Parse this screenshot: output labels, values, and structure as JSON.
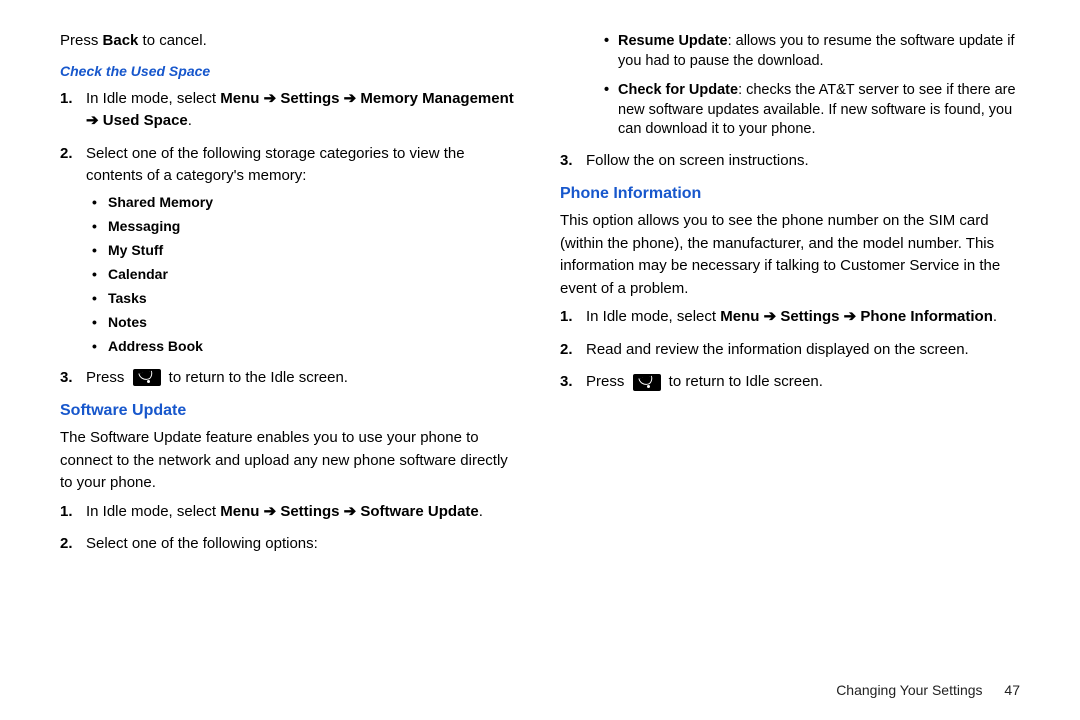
{
  "left": {
    "intro_press": "Press ",
    "intro_back": "Back",
    "intro_cancel": " to cancel.",
    "check_heading": "Check the Used Space",
    "step1_a": "In Idle mode, select ",
    "step1_b": "Menu ➔ Settings ➔ Memory Management ➔ Used Space",
    "step1_c": ".",
    "step2": "Select one of the following storage categories to view the contents of a category's memory:",
    "bullets": {
      "b1": "Shared Memory",
      "b2": "Messaging",
      "b3": "My Stuff",
      "b4": "Calendar",
      "b5": "Tasks",
      "b6": "Notes",
      "b7": "Address Book"
    },
    "step3_a": "Press ",
    "step3_b": " to return to the Idle screen.",
    "sw_heading": "Software Update",
    "sw_desc": "The Software Update feature enables you to use your phone to connect to the network and upload any new phone software directly to your phone.",
    "sw_s1_a": "In Idle mode, select ",
    "sw_s1_b": "Menu ➔ Settings ➔ Software Update",
    "sw_s1_c": ".",
    "sw_s2": "Select one of the following options:"
  },
  "right": {
    "u1_b": "Resume Update",
    "u1_t": ": allows you to resume the software update if you had to pause the download.",
    "u2_b": "Check for Update",
    "u2_t": ": checks the AT&T server to see if there are new software updates available. If new software is found, you can download it to your phone.",
    "sw_s3": "Follow the on screen instructions.",
    "pi_heading": "Phone Information",
    "pi_desc": "This option allows you to see the phone number on the SIM card (within the phone), the manufacturer, and the model number. This information may be necessary if talking to Customer Service in the event of a problem.",
    "pi_s1_a": "In Idle mode, select ",
    "pi_s1_b": "Menu ➔ Settings ➔ Phone Information",
    "pi_s1_c": ".",
    "pi_s2": "Read and review the information displayed on the screen.",
    "pi_s3_a": "Press ",
    "pi_s3_b": " to return to Idle screen."
  },
  "footer": {
    "section": "Changing Your Settings",
    "page": "47"
  }
}
